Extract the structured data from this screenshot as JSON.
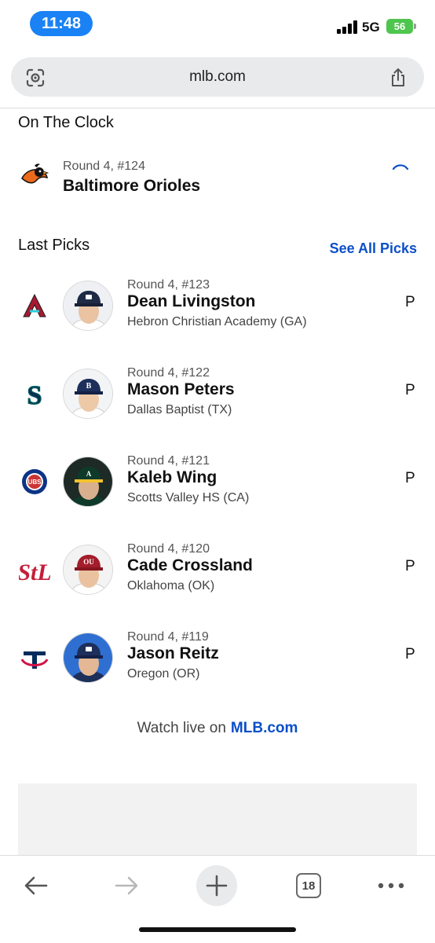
{
  "status_bar": {
    "time": "11:48",
    "network": "5G",
    "battery": "56"
  },
  "address_bar": {
    "url": "mlb.com",
    "left_icon": "lens-icon",
    "right_icon": "share-icon"
  },
  "on_the_clock": {
    "title": "On The Clock",
    "round": "Round 4, #124",
    "team": "Baltimore Orioles"
  },
  "last_picks": {
    "title": "Last Picks",
    "see_all": "See All Picks",
    "items": [
      {
        "round": "Round 4, #123",
        "name": "Dean Livingston",
        "school": "Hebron Christian Academy (GA)",
        "position": "P",
        "team_logo": "diamondbacks-logo",
        "cap_color": "#1f2b45"
      },
      {
        "round": "Round 4, #122",
        "name": "Mason Peters",
        "school": "Dallas Baptist (TX)",
        "position": "P",
        "team_logo": "mariners-logo",
        "cap_color": "#1d2f5a"
      },
      {
        "round": "Round 4, #121",
        "name": "Kaleb Wing",
        "school": "Scotts Valley HS (CA)",
        "position": "P",
        "team_logo": "cubs-logo",
        "cap_color": "#0f3a2a"
      },
      {
        "round": "Round 4, #120",
        "name": "Cade Crossland",
        "school": "Oklahoma (OK)",
        "position": "P",
        "team_logo": "cardinals-logo",
        "cap_color": "#a31d2b"
      },
      {
        "round": "Round 4, #119",
        "name": "Jason Reitz",
        "school": "Oregon (OR)",
        "position": "P",
        "team_logo": "twins-logo",
        "cap_color": "#1d2f5a"
      }
    ]
  },
  "watch_live": {
    "text": "Watch live on",
    "link": "MLB.com"
  },
  "toolbar": {
    "tab_count": "18"
  },
  "colors": {
    "accent_blue": "#0b4fc8",
    "time_pill": "#1a82f5",
    "battery": "#4ec64e"
  }
}
